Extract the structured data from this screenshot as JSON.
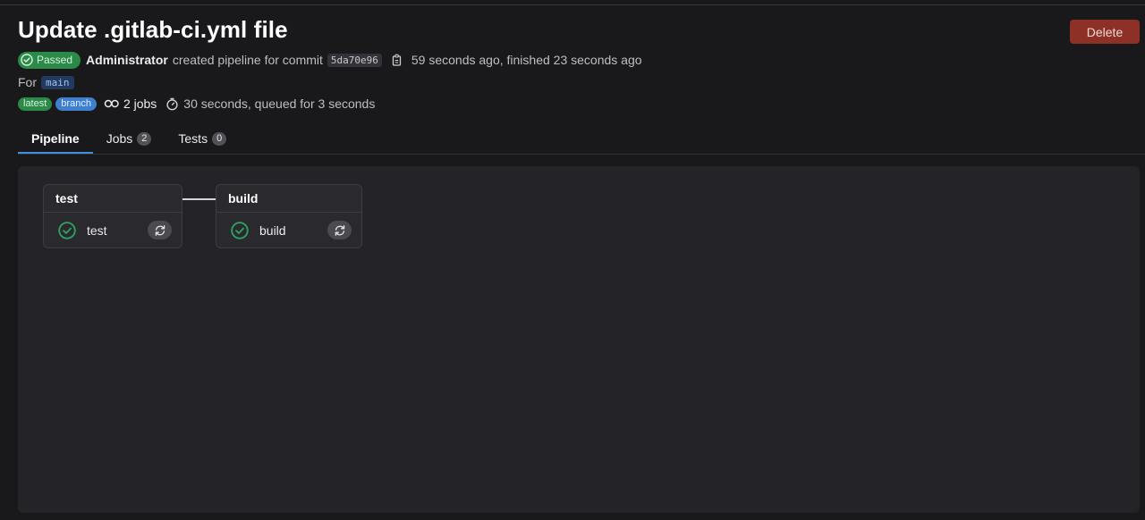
{
  "header": {
    "title": "Update .gitlab-ci.yml file",
    "delete_label": "Delete"
  },
  "pipeline": {
    "status": "Passed",
    "author": "Administrator",
    "created_text": "created pipeline for commit",
    "commit_sha": "5da70e96",
    "time_text": "59 seconds ago, finished 23 seconds ago",
    "for_label": "For",
    "ref": "main",
    "tags": [
      "latest",
      "branch"
    ],
    "jobs_text": "2 jobs",
    "duration_text": "30 seconds, queued for 3 seconds"
  },
  "tabs": [
    {
      "label": "Pipeline",
      "count": null
    },
    {
      "label": "Jobs",
      "count": "2"
    },
    {
      "label": "Tests",
      "count": "0"
    }
  ],
  "stages": [
    {
      "name": "test",
      "jobs": [
        {
          "name": "test",
          "status": "success"
        }
      ]
    },
    {
      "name": "build",
      "jobs": [
        {
          "name": "build",
          "status": "success"
        }
      ]
    }
  ],
  "colors": {
    "success": "#2da160",
    "danger": "#8d3127",
    "accent": "#428fdc"
  },
  "icons": [
    "check-circle-icon",
    "copy-icon",
    "pipeline-jobs-icon",
    "timer-icon",
    "retry-icon"
  ]
}
